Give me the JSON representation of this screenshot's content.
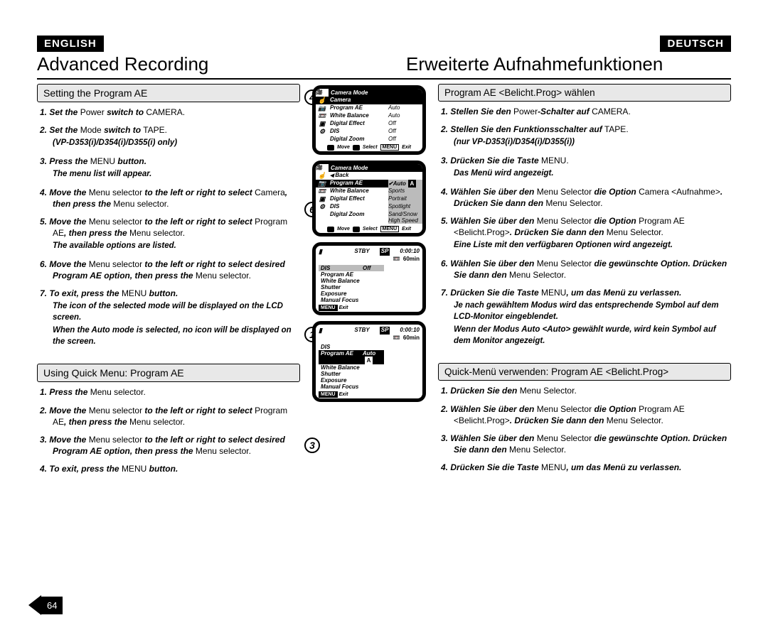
{
  "lang": {
    "en": "ENGLISH",
    "de": "DEUTSCH"
  },
  "titles": {
    "en": "Advanced Recording",
    "de": "Erweiterte Aufnahmefunktionen"
  },
  "subhead": {
    "en1": "Setting the Program AE",
    "en2": "Using Quick Menu: Program AE",
    "de1": "Program AE <Belicht.Prog> wählen",
    "de2": "Quick-Menü verwenden: Program AE <Belicht.Prog>"
  },
  "bubble": {
    "b4": "4",
    "b6": "6",
    "b1": "1",
    "b3": "3"
  },
  "en_steps_1": {
    "s1a": "1.  Set the",
    "s1b": "Power",
    "s1c": "switch to",
    "s1d": "CAMERA",
    "s2a": "2.  Set the",
    "s2b": "Mode",
    "s2c": "switch to",
    "s2d": "TAPE",
    "s2e": "(VP-D353(i)/D354(i)/D355(i) only)",
    "s3a": "3.  Press the",
    "s3b": "MENU",
    "s3c": "button.",
    "s3d": "The menu list will appear.",
    "s4a": "4.  Move the",
    "s4b": "Menu selector",
    "s4c": "to the left or right to select",
    "s4d": "Camera",
    "s4e": ", then press the",
    "s4f": "Menu selector",
    "s5a": "5.  Move the",
    "s5b": "Menu selector",
    "s5c": "to the left or right to select",
    "s5d": "Program AE",
    "s5e": ", then press the",
    "s5f": "Menu selector",
    "s5g": "The available options are listed.",
    "s6a": "6.  Move the",
    "s6b": "Menu selector",
    "s6c": "to the left or right to select desired",
    "s6d": "Program AE option, then press the",
    "s6e": "Menu selector",
    "s7a": "7.  To exit, press the",
    "s7b": "MENU",
    "s7c": "button.",
    "s7d": "The icon of the selected mode will be displayed on the LCD screen.",
    "s7e": "When the Auto mode is selected, no icon will be displayed on the screen."
  },
  "en_steps_2": {
    "s1a": "1.  Press the",
    "s1b": "Menu selector",
    "s2a": "2.  Move the",
    "s2b": "Menu selector",
    "s2c": "to the left or right to select",
    "s2d": "Program AE",
    "s2e": ", then press the",
    "s2f": "Menu selector",
    "s3a": "3.  Move the",
    "s3b": "Menu selector",
    "s3c": "to the left or right to select",
    "s3d": "desired Program AE option, then press the",
    "s3e": "Menu selector",
    "s4a": "4.  To exit, press the",
    "s4b": "MENU",
    "s4c": "button."
  },
  "de_steps_1": {
    "s1a": "1.  Stellen Sie den",
    "s1b": "Power",
    "s1c": "-Schalter auf",
    "s1d": "CAMERA",
    "s2a": "2.  Stellen Sie den Funktionsschalter auf",
    "s2b": "TAPE",
    "s2c": "(nur VP-D353(i)/D354(i)/D355(i))",
    "s3a": "3.  Drücken Sie die Taste",
    "s3b": "MENU",
    "s3c": "Das Menü wird angezeigt.",
    "s4a": "4.  Wählen Sie über den",
    "s4b": "Menu Selector",
    "s4c": "die Option",
    "s4d": "Camera",
    "s4e": "<Aufnahme>",
    "s4f": ". Drücken Sie dann den",
    "s4g": "Menu Selector",
    "s5a": "5.  Wählen Sie über den",
    "s5b": "Menu Selector",
    "s5c": "die Option",
    "s5d": "Program AE <Belicht.Prog>",
    "s5e": ". Drücken Sie dann den",
    "s5f": "Menu Selector",
    "s5g": "Eine Liste mit den verfügbaren Optionen wird angezeigt.",
    "s6a": "6.  Wählen Sie über den",
    "s6b": "Menu Selector",
    "s6c": "die gewünschte",
    "s6d": "Option. Drücken Sie dann den",
    "s6e": "Menu Selector",
    "s7a": "7.  Drücken Sie die Taste",
    "s7b": "MENU",
    "s7c": ", um das Menü zu verlassen.",
    "s7d": "Je nach gewähltem Modus wird das entsprechende Symbol auf dem LCD-Monitor eingeblendet.",
    "s7e": "Wenn der Modus Auto <Auto> gewählt wurde, wird kein Symbol auf dem Monitor angezeigt."
  },
  "de_steps_2": {
    "s1a": "1.  Drücken Sie den",
    "s1b": "Menu Selector",
    "s2a": "2.  Wählen Sie über den",
    "s2b": "Menu Selector",
    "s2c": "die Option",
    "s2d": "Program AE <Belicht.Prog>",
    "s2e": ". Drücken Sie dann den",
    "s2f": "Menu Selector",
    "s3a": "3.  Wählen Sie über den",
    "s3b": "Menu Selector",
    "s3c": "die gewünschte",
    "s3d": "Option. Drücken Sie dann den",
    "s3e": "Menu Selector",
    "s4a": "4.  Drücken Sie die Taste",
    "s4b": "MENU",
    "s4c": ", um das Menü zu verlassen."
  },
  "screen4": {
    "title": "Camera Mode",
    "sub": "Camera",
    "rows": [
      {
        "l": "Program AE",
        "v": "Auto"
      },
      {
        "l": "White Balance",
        "v": "Auto"
      },
      {
        "l": "Digital Effect",
        "v": "Off"
      },
      {
        "l": "DIS",
        "v": "Off"
      },
      {
        "l": "Digital Zoom",
        "v": "Off"
      }
    ],
    "footer": {
      "move": "Move",
      "select": "Select",
      "menu": "MENU",
      "exit": "Exit"
    }
  },
  "screen6": {
    "title": "Camera Mode",
    "back": "Back",
    "rows": [
      {
        "l": "Program AE",
        "v": "✔Auto",
        "badge": "A",
        "sel": true
      },
      {
        "l": "White Balance",
        "v": "Sports"
      },
      {
        "l": "Digital Effect",
        "v": "Portrait"
      },
      {
        "l": "DIS",
        "v": "Spotlight"
      },
      {
        "l": "Digital Zoom",
        "v": "Sand/Snow"
      },
      {
        "l": "",
        "v": "High Speed"
      }
    ],
    "footer": {
      "move": "Move",
      "select": "Select",
      "menu": "MENU",
      "exit": "Exit"
    }
  },
  "qscreen1": {
    "stby": "STBY",
    "sp": "SP",
    "tc": "0:00:10",
    "tape": "60min",
    "rows": [
      {
        "l": "DIS",
        "v": "Off",
        "grey": true
      },
      {
        "l": "Program AE"
      },
      {
        "l": "White Balance"
      },
      {
        "l": "Shutter"
      },
      {
        "l": "Exposure"
      },
      {
        "l": "Manual Focus"
      }
    ],
    "menu": "MENU",
    "exit": "Exit"
  },
  "qscreen3": {
    "stby": "STBY",
    "sp": "SP",
    "tc": "0:00:10",
    "tape": "60min",
    "rows": [
      {
        "l": "DIS"
      },
      {
        "l": "Program AE",
        "v": "Auto",
        "badge": "A",
        "sel": true
      },
      {
        "l": "White Balance"
      },
      {
        "l": "Shutter"
      },
      {
        "l": "Exposure"
      },
      {
        "l": "Manual Focus"
      }
    ],
    "menu": "MENU",
    "exit": "Exit"
  },
  "pagenum": "64"
}
